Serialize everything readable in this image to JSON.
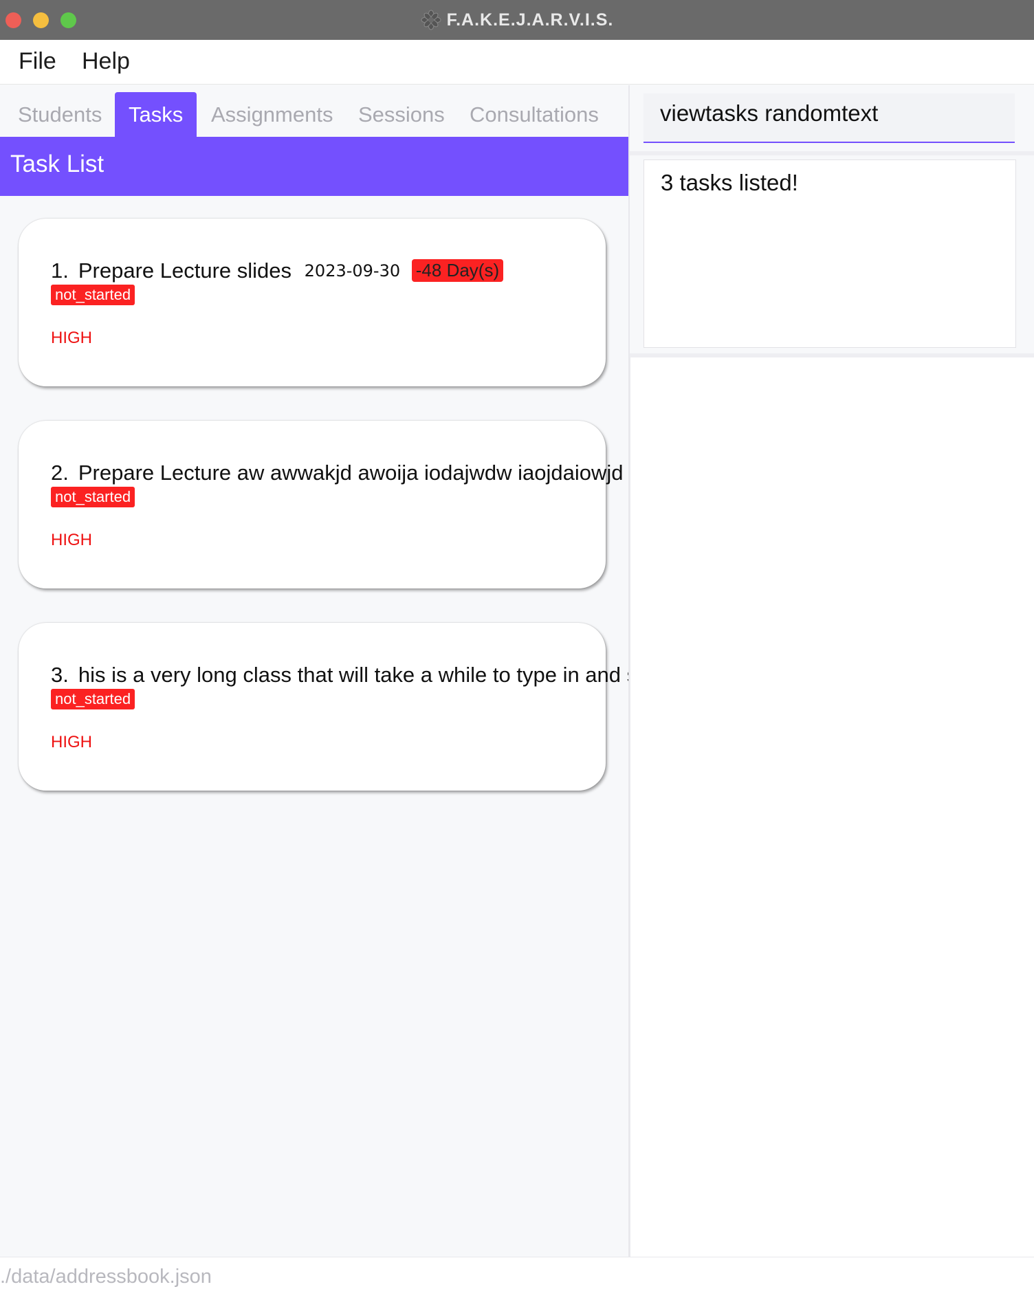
{
  "window": {
    "title": "F.A.K.E.J.A.R.V.I.S.",
    "app_icon": "gear-flower-icon"
  },
  "menu": {
    "items": [
      "File",
      "Help"
    ]
  },
  "tabs": [
    "Students",
    "Tasks",
    "Assignments",
    "Sessions",
    "Consultations"
  ],
  "active_tab": "Tasks",
  "list": {
    "header": "Task List",
    "tasks": [
      {
        "index": "1.",
        "name": "Prepare Lecture slides",
        "date": "2023-09-30",
        "overdue": "-48 Day(s)",
        "status": "not_started",
        "priority": "HIGH"
      },
      {
        "index": "2.",
        "name": "Prepare Lecture aw awwakjd awoija iodajwdw iaojdaiowjd aiodjaw",
        "status": "not_started",
        "priority": "HIGH"
      },
      {
        "index": "3.",
        "name": "his is a very long class that will take a while to type in and stuff",
        "status": "not_started",
        "priority": "HIGH"
      }
    ]
  },
  "command": {
    "value": "viewtasks randomtext"
  },
  "result": {
    "text": "3 tasks listed!"
  },
  "statusbar": {
    "path": "./data/addressbook.json"
  },
  "colors": {
    "accent": "#7450fe",
    "alert": "#fb2222",
    "titlebar": "#6a6a6a"
  }
}
